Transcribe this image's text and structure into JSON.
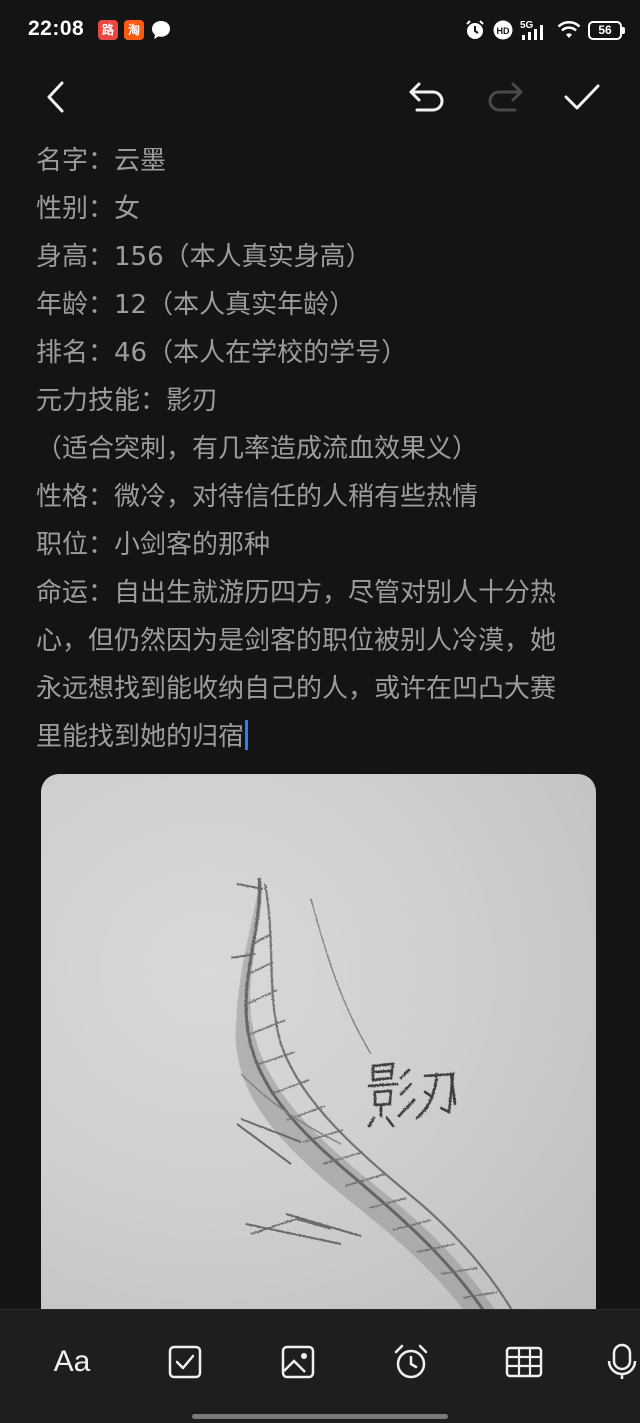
{
  "status_bar": {
    "time": "22:08",
    "app_badges": [
      "路",
      "淘"
    ],
    "battery": "56",
    "network": "5G",
    "hd": "HD"
  },
  "toolbar": {
    "back_icon": "back-arrow-icon",
    "undo_icon": "undo-icon",
    "redo_icon": "redo-icon",
    "done_icon": "checkmark-icon"
  },
  "note": {
    "lines": [
      "名字：云墨",
      "性别：女",
      "身高：156（本人真实身高）",
      "年龄：12（本人真实年龄）",
      "排名：46（本人在学校的学号）",
      "元力技能：影刃",
      "（适合突刺，有几率造成流血效果义）",
      "性格：微冷，对待信任的人稍有些热情",
      "职位：小剑客的那种",
      "命运：自出生就游历四方，尽管对别人十分热",
      "心，但仍然因为是剑客的职位被别人冷漠，她",
      "永远想找到能收纳自己的人，或许在凹凸大赛",
      "里能找到她的归宿"
    ]
  },
  "photo": {
    "handwritten_text": "影刃"
  },
  "bottom_bar": {
    "format_label": "Aa",
    "icons": [
      "checklist-icon",
      "image-icon",
      "alarm-icon",
      "table-icon",
      "microphone-icon"
    ]
  },
  "colors": {
    "background": "#141414",
    "text": "#9c9c9c",
    "cursor": "#2f7bff",
    "bottom_bar": "#1e1e1e"
  }
}
